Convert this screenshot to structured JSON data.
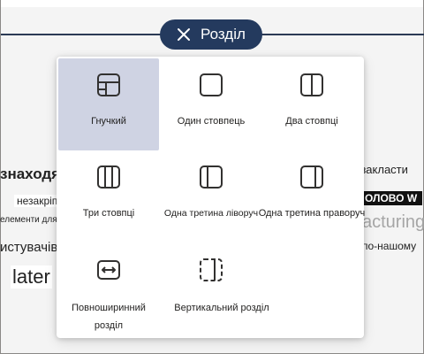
{
  "section_button": {
    "label": "Розділ",
    "icon": "close-icon"
  },
  "background_fragments": [
    "знаходяться в",
    "незакріплено",
    "елементи для",
    "истувачів t",
    "later",
    ")закласти",
    "ОЛОВО W",
    "acturing",
    "по-нашому"
  ],
  "layouts": [
    {
      "label": "Гнучкий",
      "icon": "flexible-layout-icon",
      "selected": true
    },
    {
      "label": "Один стовпець",
      "icon": "one-column-icon",
      "selected": false
    },
    {
      "label": "Два стовпці",
      "icon": "two-columns-icon",
      "selected": false
    },
    {
      "label": "Три стовпці",
      "icon": "three-columns-icon",
      "selected": false
    },
    {
      "label": "Одна третина ліворуч",
      "icon": "one-third-left-icon",
      "selected": false
    },
    {
      "label": "Одна третина праворуч",
      "icon": "one-third-right-icon",
      "selected": false
    },
    {
      "label_line1": "Повноширинний",
      "label_line2": "розділ",
      "icon": "full-width-icon",
      "selected": false
    },
    {
      "label": "Вертикальний розділ",
      "icon": "vertical-section-icon",
      "selected": false
    }
  ],
  "colors": {
    "pill": "#243a5e",
    "selected": "#cfd3e3",
    "line": "#2b3a55"
  }
}
